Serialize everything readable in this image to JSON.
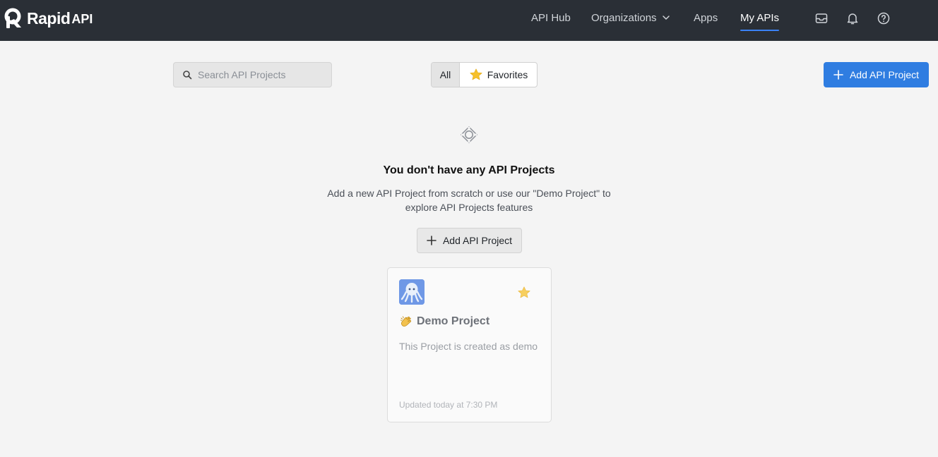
{
  "brand": {
    "name": "Rapid",
    "suffix": "API"
  },
  "nav": {
    "items": [
      {
        "label": "API Hub"
      },
      {
        "label": "Organizations"
      },
      {
        "label": "Apps"
      },
      {
        "label": "My APIs"
      }
    ],
    "active": "My APIs",
    "icons": [
      "inbox-icon",
      "bell-icon",
      "help-icon"
    ]
  },
  "toolbar": {
    "search_placeholder": "Search API Projects",
    "filter_all": "All",
    "filter_favorites": "Favorites",
    "add_button": "Add API Project"
  },
  "empty_state": {
    "title": "You don't have any API Projects",
    "description": "Add a new API Project from scratch or use our \"Demo Project\" to explore API Projects features",
    "button": "Add API Project"
  },
  "demo_card": {
    "title": "Demo Project",
    "description": "This Project is created as demo",
    "updated": "Updated today at 7:30 PM",
    "favorited": true
  },
  "colors": {
    "topbar": "#2a2f36",
    "accent": "#2f7de1",
    "background": "#f4f4f4",
    "star": "#f6c02b"
  }
}
